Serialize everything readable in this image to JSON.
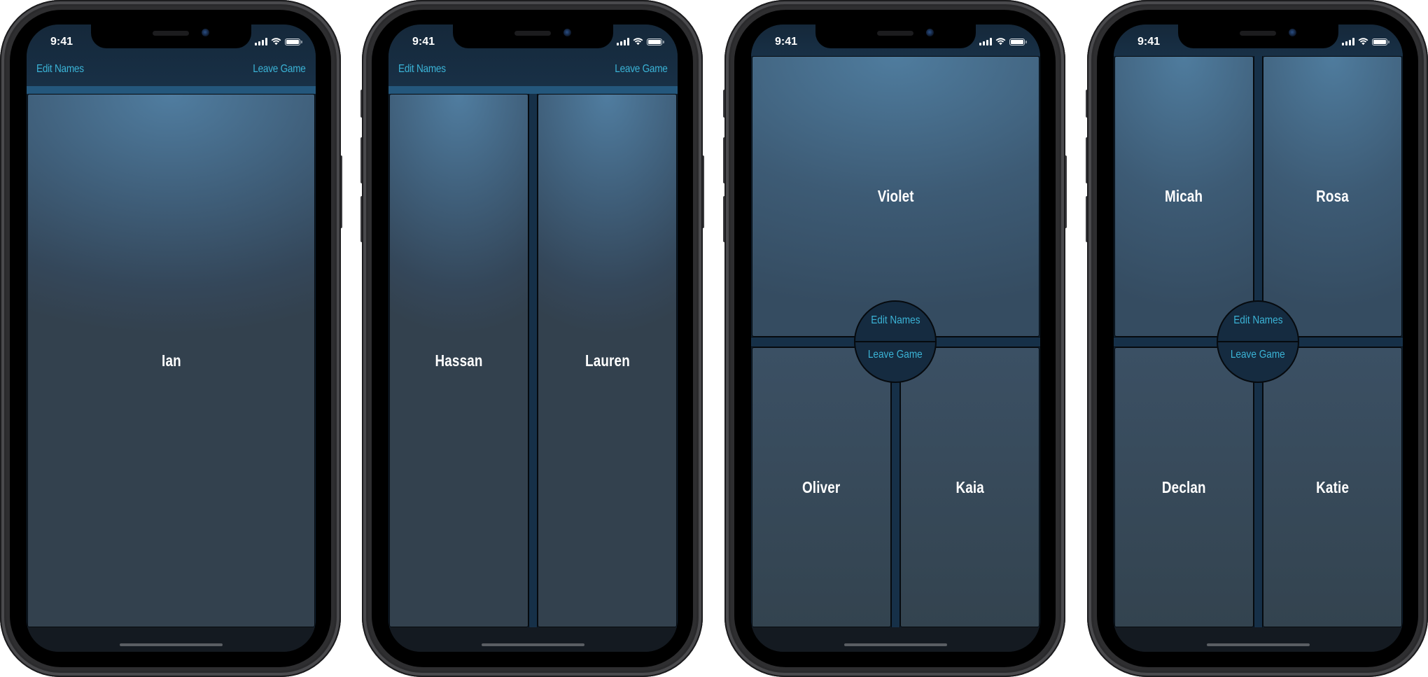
{
  "status_bar": {
    "time": "9:41",
    "icons": [
      "cellular-signal-icon",
      "wifi-icon",
      "battery-icon"
    ]
  },
  "controls": {
    "edit_names": "Edit Names",
    "leave_game": "Leave Game"
  },
  "colors": {
    "accent": "#3bb3d6",
    "panel_top": "#4f7c9e",
    "panel_bottom": "#33434f",
    "divider": "#163048",
    "header": "#15283a"
  },
  "phones": [
    {
      "layout": "single",
      "players": [
        "Ian"
      ]
    },
    {
      "layout": "two-column",
      "players": [
        "Hassan",
        "Lauren"
      ]
    },
    {
      "layout": "one-top-two-bottom",
      "players": [
        "Violet",
        "Oliver",
        "Kaia"
      ]
    },
    {
      "layout": "grid-2x2",
      "players": [
        "Micah",
        "Rosa",
        "Declan",
        "Katie"
      ]
    }
  ]
}
